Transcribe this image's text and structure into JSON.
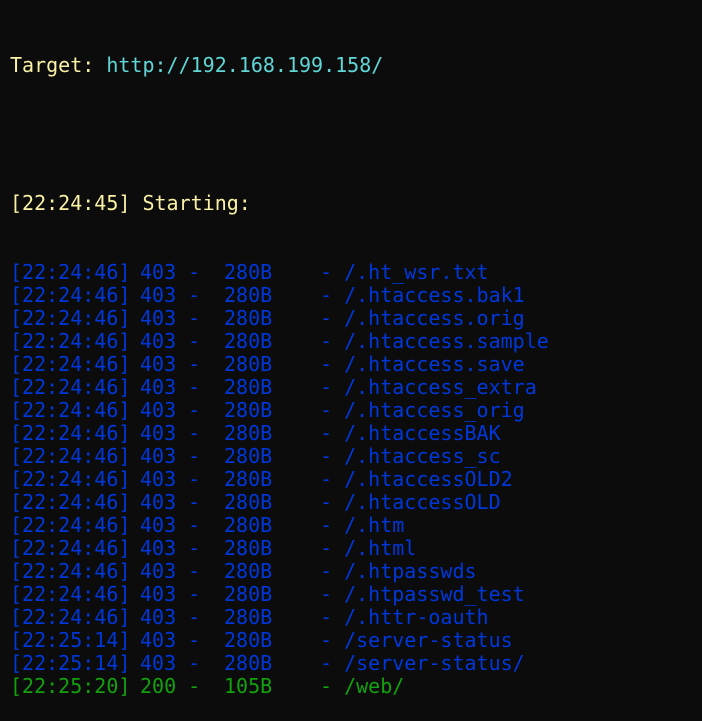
{
  "target": {
    "label": "Target: ",
    "url": "http://192.168.199.158/"
  },
  "start": {
    "timestamp": "[22:24:45]",
    "text": " Starting:"
  },
  "colors": {
    "background": "#0c0c0c",
    "yellow": "#f9f1a5",
    "cyan": "#61d6d6",
    "blue": "#0037da",
    "green": "#13a10e"
  },
  "results": [
    {
      "timestamp": "[22:24:46]",
      "status": "403 -",
      "size": "280B",
      "path": "- /.ht_wsr.txt",
      "color": "#0037da"
    },
    {
      "timestamp": "[22:24:46]",
      "status": "403 -",
      "size": "280B",
      "path": "- /.htaccess.bak1",
      "color": "#0037da"
    },
    {
      "timestamp": "[22:24:46]",
      "status": "403 -",
      "size": "280B",
      "path": "- /.htaccess.orig",
      "color": "#0037da"
    },
    {
      "timestamp": "[22:24:46]",
      "status": "403 -",
      "size": "280B",
      "path": "- /.htaccess.sample",
      "color": "#0037da"
    },
    {
      "timestamp": "[22:24:46]",
      "status": "403 -",
      "size": "280B",
      "path": "- /.htaccess.save",
      "color": "#0037da"
    },
    {
      "timestamp": "[22:24:46]",
      "status": "403 -",
      "size": "280B",
      "path": "- /.htaccess_extra",
      "color": "#0037da"
    },
    {
      "timestamp": "[22:24:46]",
      "status": "403 -",
      "size": "280B",
      "path": "- /.htaccess_orig",
      "color": "#0037da"
    },
    {
      "timestamp": "[22:24:46]",
      "status": "403 -",
      "size": "280B",
      "path": "- /.htaccessBAK",
      "color": "#0037da"
    },
    {
      "timestamp": "[22:24:46]",
      "status": "403 -",
      "size": "280B",
      "path": "- /.htaccess_sc",
      "color": "#0037da"
    },
    {
      "timestamp": "[22:24:46]",
      "status": "403 -",
      "size": "280B",
      "path": "- /.htaccessOLD2",
      "color": "#0037da"
    },
    {
      "timestamp": "[22:24:46]",
      "status": "403 -",
      "size": "280B",
      "path": "- /.htaccessOLD",
      "color": "#0037da"
    },
    {
      "timestamp": "[22:24:46]",
      "status": "403 -",
      "size": "280B",
      "path": "- /.htm",
      "color": "#0037da"
    },
    {
      "timestamp": "[22:24:46]",
      "status": "403 -",
      "size": "280B",
      "path": "- /.html",
      "color": "#0037da"
    },
    {
      "timestamp": "[22:24:46]",
      "status": "403 -",
      "size": "280B",
      "path": "- /.htpasswds",
      "color": "#0037da"
    },
    {
      "timestamp": "[22:24:46]",
      "status": "403 -",
      "size": "280B",
      "path": "- /.htpasswd_test",
      "color": "#0037da"
    },
    {
      "timestamp": "[22:24:46]",
      "status": "403 -",
      "size": "280B",
      "path": "- /.httr-oauth",
      "color": "#0037da"
    },
    {
      "timestamp": "[22:25:14]",
      "status": "403 -",
      "size": "280B",
      "path": "- /server-status",
      "color": "#0037da"
    },
    {
      "timestamp": "[22:25:14]",
      "status": "403 -",
      "size": "280B",
      "path": "- /server-status/",
      "color": "#0037da"
    },
    {
      "timestamp": "[22:25:20]",
      "status": "200 -",
      "size": "105B",
      "path": "- /web/",
      "color": "#13a10e"
    }
  ]
}
